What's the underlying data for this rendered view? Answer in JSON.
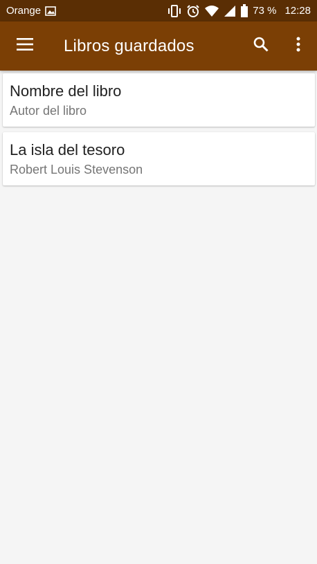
{
  "status_bar": {
    "carrier": "Orange",
    "battery": "73 %",
    "time": "12:28",
    "icons": [
      "image-icon",
      "vibrate-icon",
      "alarm-icon",
      "wifi-icon",
      "signal-icon",
      "battery-icon"
    ]
  },
  "app_bar": {
    "title": "Libros guardados",
    "color": "#7b3f05",
    "status_color": "#5a2e04",
    "icons": [
      "menu-icon",
      "search-icon",
      "more-vert-icon"
    ]
  },
  "books": [
    {
      "title": "Nombre del libro",
      "author": "Autor del libro"
    },
    {
      "title": "La isla del tesoro",
      "author": "Robert Louis Stevenson"
    }
  ]
}
